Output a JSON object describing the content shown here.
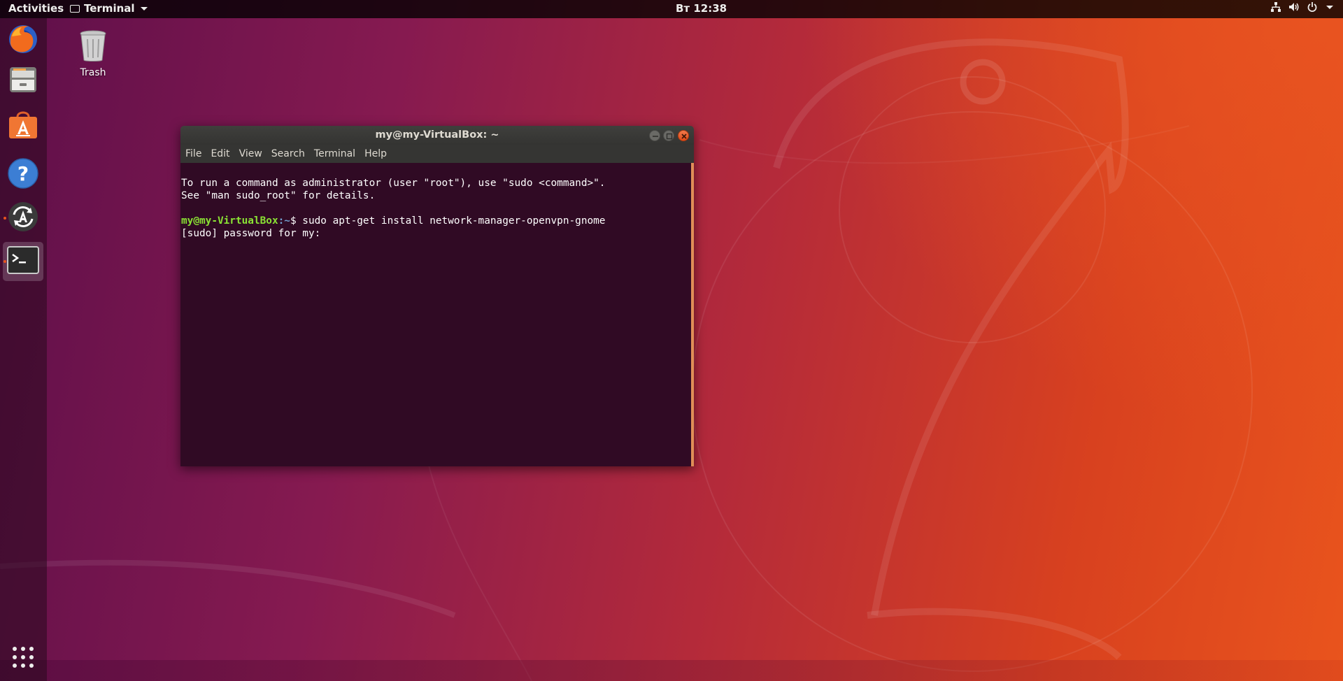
{
  "topbar": {
    "activities": "Activities",
    "app_name": "Terminal",
    "clock": "Вт 12:38"
  },
  "dock": {
    "items": [
      {
        "name": "Firefox Web Browser",
        "icon": "firefox-icon"
      },
      {
        "name": "Files",
        "icon": "files-icon"
      },
      {
        "name": "Ubuntu Software",
        "icon": "software-center-icon"
      },
      {
        "name": "Help",
        "icon": "help-icon"
      },
      {
        "name": "Software Updater",
        "icon": "software-updater-icon"
      },
      {
        "name": "Terminal",
        "icon": "terminal-icon",
        "active": true
      }
    ],
    "show_apps_icon": "show-applications-icon"
  },
  "desktop": {
    "trash_label": "Trash"
  },
  "terminal": {
    "title": "my@my-VirtualBox: ~",
    "menu": [
      "File",
      "Edit",
      "View",
      "Search",
      "Terminal",
      "Help"
    ],
    "lines": {
      "line1": "To run a command as administrator (user \"root\"), use \"sudo <command>\".",
      "line2": "See \"man sudo_root\" for details.",
      "prompt_user": "my@my-VirtualBox",
      "prompt_path": ":~",
      "prompt_symbol": "$ ",
      "command": "sudo apt-get install network-manager-openvpn-gnome",
      "line4": "[sudo] password for my: "
    }
  },
  "colors": {
    "terminal_bg": "#300a24",
    "accent": "#e9541d",
    "prompt_user": "#8ae234",
    "prompt_path": "#729fcf"
  }
}
